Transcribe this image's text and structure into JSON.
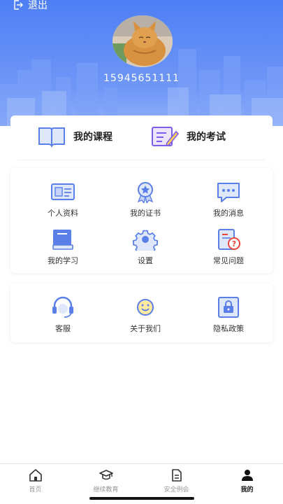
{
  "header": {
    "logout_label": "退出",
    "phone": "15945651111",
    "gradient_top": "#4f7ff5",
    "gradient_bottom": "#8fb0f9"
  },
  "top_links": [
    {
      "label": "我的课程",
      "icon": "open-book-icon"
    },
    {
      "label": "我的考试",
      "icon": "exam-pencil-icon"
    }
  ],
  "grid1": [
    {
      "label": "个人资料",
      "icon": "id-card-icon"
    },
    {
      "label": "我的证书",
      "icon": "medal-icon"
    },
    {
      "label": "我的消息",
      "icon": "chat-bubble-icon"
    },
    {
      "label": "我的学习",
      "icon": "book-icon"
    },
    {
      "label": "设置",
      "icon": "gear-icon"
    },
    {
      "label": "常见问题",
      "icon": "faq-doc-icon"
    }
  ],
  "grid2": [
    {
      "label": "客服",
      "icon": "headset-icon"
    },
    {
      "label": "关于我们",
      "icon": "smiley-icon"
    },
    {
      "label": "隐私政策",
      "icon": "lock-doc-icon"
    }
  ],
  "tabs": [
    {
      "label": "首页",
      "icon": "home-icon",
      "active": false
    },
    {
      "label": "继续教育",
      "icon": "graduation-cap-icon",
      "active": false
    },
    {
      "label": "安全例会",
      "icon": "document-icon",
      "active": false
    },
    {
      "label": "我的",
      "icon": "user-icon",
      "active": true
    }
  ],
  "colors": {
    "accent": "#4f7ff5",
    "icon_blue": "#5b7fe8",
    "icon_purple": "#7d5ce8",
    "icon_red": "#e8463c"
  }
}
